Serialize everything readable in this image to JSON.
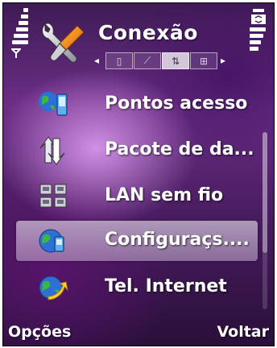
{
  "header": {
    "title": "Conexão",
    "title_icon": "wrench-tools-icon"
  },
  "tabs": [
    {
      "icon": "phone-tab-icon",
      "glyph": "▯",
      "active": false
    },
    {
      "icon": "link-tab-icon",
      "glyph": "⟋",
      "active": false
    },
    {
      "icon": "data-transfer-tab-icon",
      "glyph": "⇅",
      "active": true
    },
    {
      "icon": "network-tab-icon",
      "glyph": "⊞",
      "active": false
    }
  ],
  "menu": [
    {
      "label": "Pontos acesso",
      "icon": "access-points-icon",
      "selected": false
    },
    {
      "label": "Pacote de da...",
      "icon": "packet-data-icon",
      "selected": false
    },
    {
      "label": "LAN sem fio",
      "icon": "wlan-icon",
      "selected": false
    },
    {
      "label": "Configuraçs....",
      "icon": "config-globe-icon",
      "selected": true
    },
    {
      "label": "Tel. Internet",
      "icon": "internet-tel-icon",
      "selected": false
    }
  ],
  "softkeys": {
    "left": "Opções",
    "right": "Voltar"
  },
  "colors": {
    "background_top": "#3e1b55",
    "background_mid": "#6c2e86",
    "highlight": "#e6d2f0",
    "text": "#ffffff"
  }
}
